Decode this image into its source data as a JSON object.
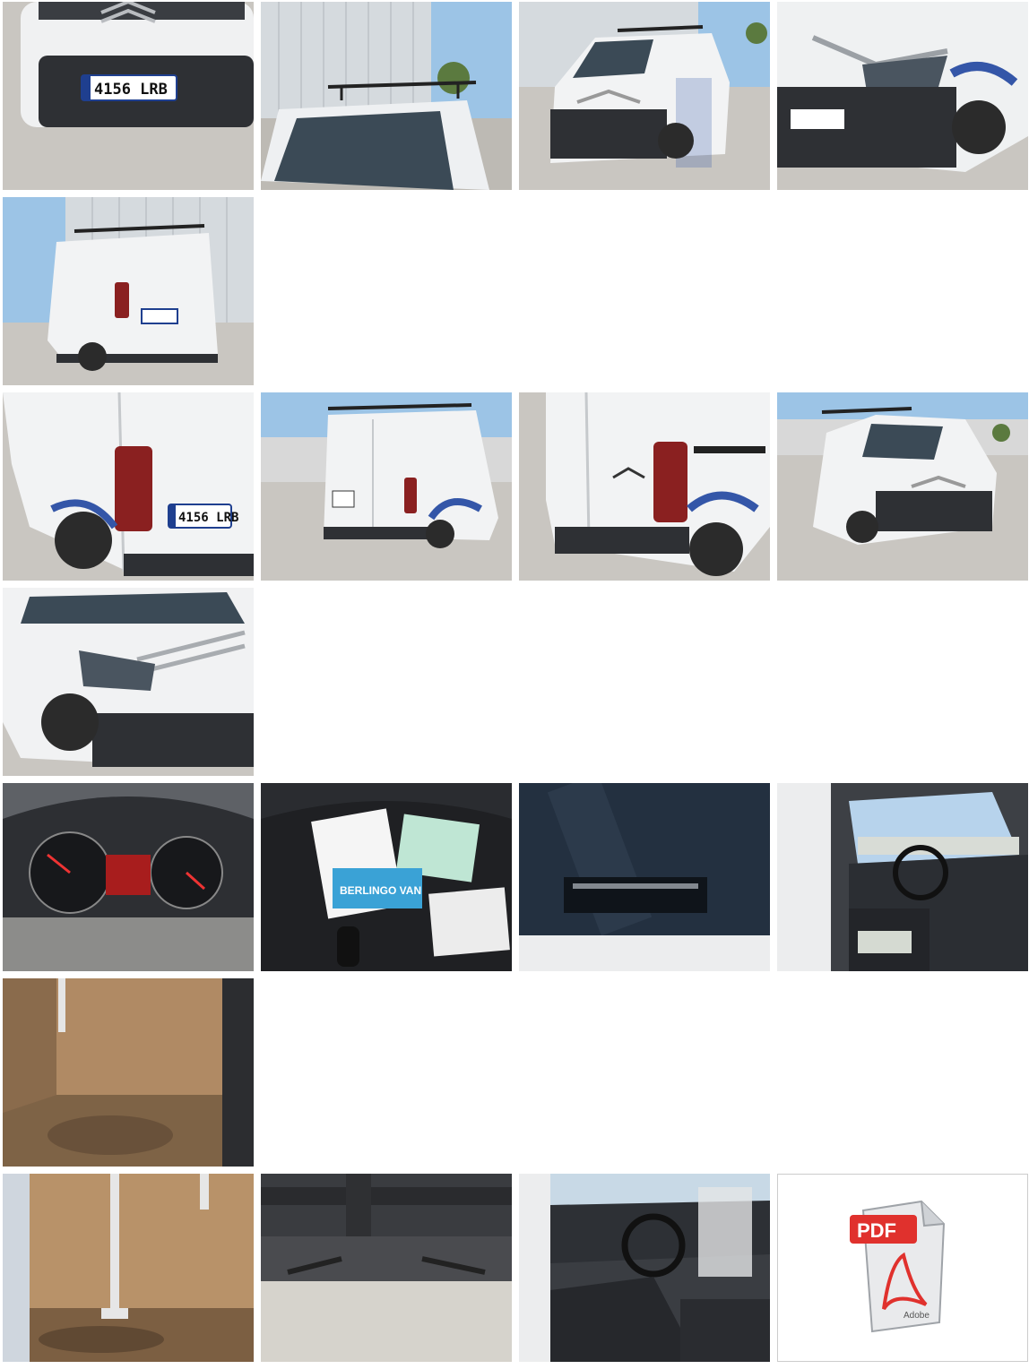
{
  "gallery": {
    "photos": [
      {
        "icon": "van-front-plate-photo",
        "plate": "4156 LRB"
      },
      {
        "icon": "van-roof-rack-photo"
      },
      {
        "icon": "van-front-three-quarter-photo"
      },
      {
        "icon": "van-front-headlight-photo"
      },
      {
        "icon": "van-rear-three-quarter-photo"
      },
      {
        "icon": "van-rear-left-photo",
        "plate": "4156 LRB"
      },
      {
        "icon": "van-rear-doors-photo"
      },
      {
        "icon": "van-rear-right-photo"
      },
      {
        "icon": "van-front-left-photo"
      },
      {
        "icon": "van-front-bumper-photo"
      },
      {
        "icon": "dashboard-instruments-photo"
      },
      {
        "icon": "documents-and-key-photo",
        "doc_label": "BERLINGO VAN"
      },
      {
        "icon": "windshield-sticker-photo"
      },
      {
        "icon": "cabin-interior-photo"
      },
      {
        "icon": "cargo-area-photo"
      },
      {
        "icon": "cargo-partition-photo"
      },
      {
        "icon": "underbody-photo"
      },
      {
        "icon": "driver-seat-interior-photo"
      }
    ],
    "pdf_tile": {
      "icon": "pdf-document-icon",
      "badge": "PDF",
      "brand": "Adobe"
    }
  },
  "colors": {
    "sky": "#9cc4e6",
    "van_white": "#f2f3f4",
    "asphalt": "#c9c6c1",
    "wall": "#d9dde2",
    "tyre": "#2b2b2b",
    "blue_trim": "#3456a8",
    "pdf_red": "#e0312d"
  }
}
